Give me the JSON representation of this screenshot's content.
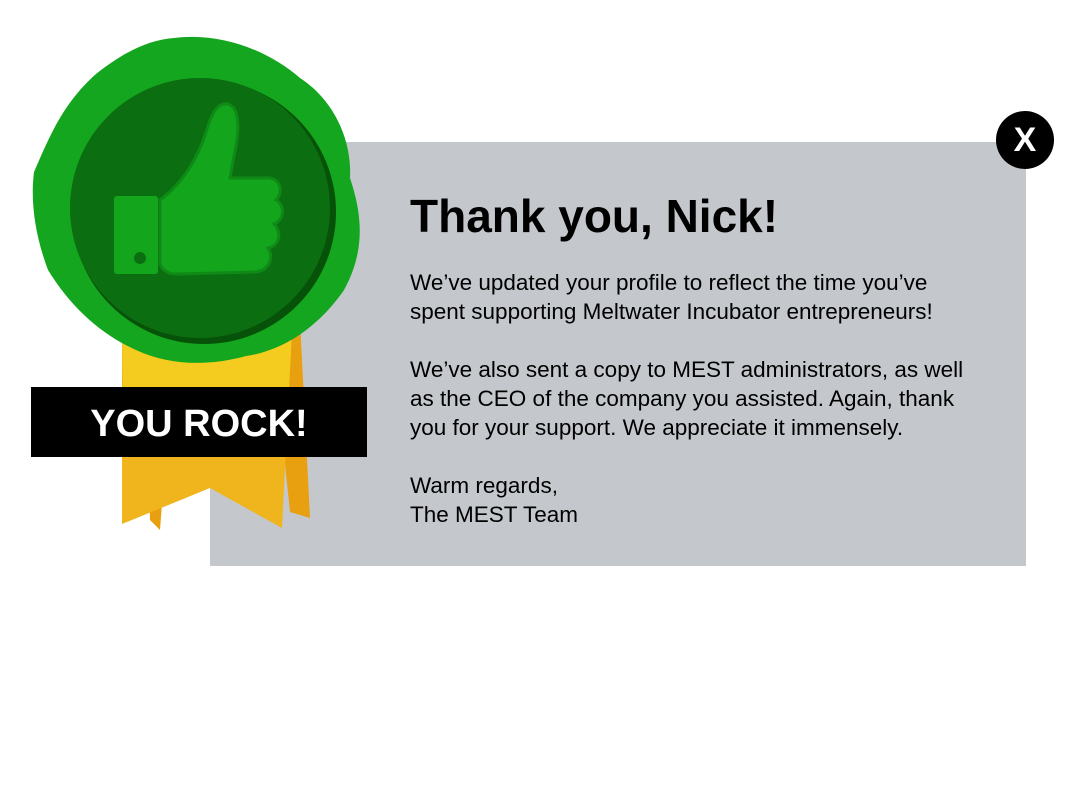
{
  "modal": {
    "title": "Thank you, Nick!",
    "paragraph_1": [
      "We’ve updated your profile to reflect the time you’ve",
      "spent supporting Meltwater Incubator entrepreneurs!"
    ],
    "paragraph_2": [
      "We’ve also sent a copy to MEST administrators, as well",
      "as the CEO of the company you assisted. Again, thank",
      "you for your support. We appreciate it immensely."
    ],
    "signoff": [
      "Warm regards,",
      "The MEST Team"
    ],
    "close_label": "X",
    "panel_color": "#c4c8cc"
  },
  "badge": {
    "banner_text": "YOU ROCK!",
    "icon": "thumbs-up-icon",
    "colors": {
      "rosette": "#14a61e",
      "medallion": "#0b6e10",
      "ribbon": "#f0b41c",
      "banner": "#000000"
    }
  }
}
